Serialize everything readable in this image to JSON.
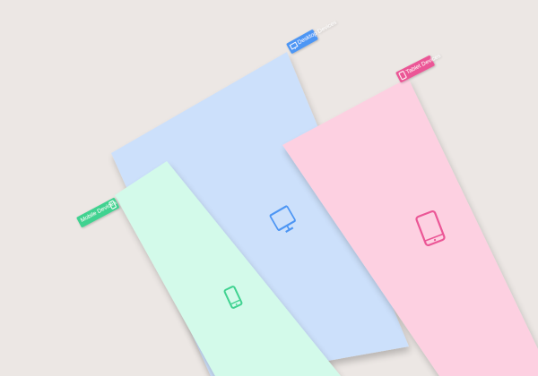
{
  "mockup": {
    "colors": {
      "background": "#ece7e4",
      "desktop_sheet": "#cce0fb",
      "tablet_sheet": "#fdd0e1",
      "mobile_sheet": "#d3faea",
      "desktop_accent": "#4d96f4",
      "tablet_accent": "#eb5696",
      "mobile_accent": "#3fd290"
    },
    "sheets": [
      {
        "id": "desktop",
        "icon": "monitor-icon",
        "tag_title": "Desktop Devices",
        "tag_subtitle": ""
      },
      {
        "id": "tablet",
        "icon": "tablet-icon",
        "tag_title": "Tablet Devices",
        "tag_subtitle": ""
      },
      {
        "id": "mobile",
        "icon": "smartphone-icon",
        "tag_title": "Mobile Devices",
        "tag_subtitle": ""
      }
    ]
  }
}
